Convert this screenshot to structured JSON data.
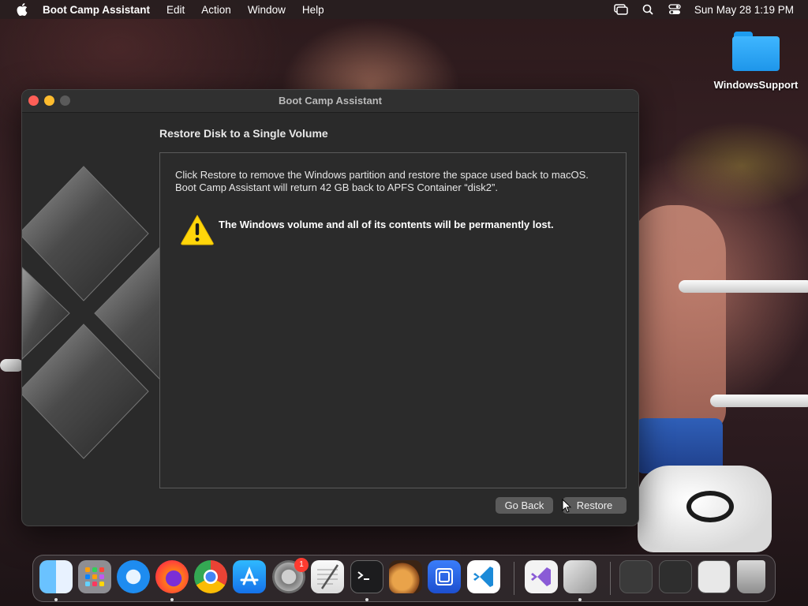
{
  "menubar": {
    "app_name": "Boot Camp Assistant",
    "menus": [
      "Edit",
      "Action",
      "Window",
      "Help"
    ],
    "status_icons": [
      "screen-mirroring-icon",
      "search-icon",
      "control-center-icon"
    ],
    "datetime": "Sun May 28  1:19 PM"
  },
  "desktop": {
    "folder_label": "WindowsSupport"
  },
  "window": {
    "title": "Boot Camp Assistant",
    "heading": "Restore Disk to a Single Volume",
    "description_line1": "Click Restore to remove the Windows partition and restore the space used back to macOS.",
    "description_line2": "Boot Camp Assistant will return 42 GB back to APFS Container “disk2”.",
    "warning": "The Windows volume and all of its contents will be permanently lost.",
    "buttons": {
      "back": "Go Back",
      "restore": "Restore"
    }
  },
  "dock": {
    "apps": [
      "Finder",
      "Launchpad",
      "Safari",
      "Firefox",
      "Google Chrome",
      "App Store",
      "System Preferences",
      "TextEdit",
      "Terminal",
      "GarageBand",
      "Remote Desktop",
      "Visual Studio Code",
      "Visual Studio",
      "Boot Camp Assistant",
      "Window 1",
      "Window 2",
      "Window 3",
      "Trash"
    ],
    "system_prefs_badge": "1"
  },
  "colors": {
    "close": "#ff5f57",
    "minimize": "#febc2e",
    "warning_yellow": "#ffd60a",
    "button_bg": "#5b5b5b"
  }
}
